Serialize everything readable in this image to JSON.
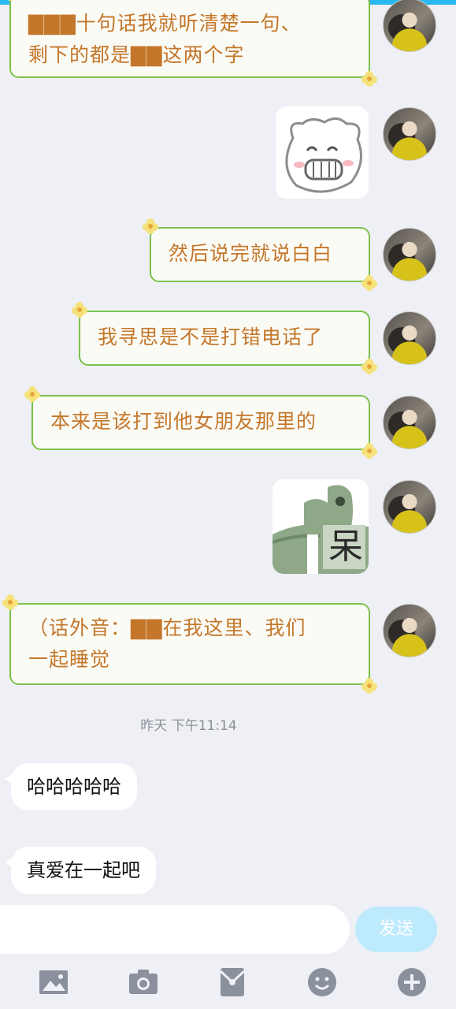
{
  "colors": {
    "accent": "#29b8f0",
    "bubble_border": "#7bc14a",
    "bubble_text": "#c4772a",
    "send_button": "#bdeafc",
    "toolbar_icon": "#8a909c"
  },
  "messages_sent": [
    {
      "lines": [
        "▇▇▇十句话我就听清楚一句、",
        "剩下的都是▇▇这两个字"
      ]
    },
    {
      "sticker": "smiling-pig-sticker"
    },
    {
      "lines": [
        "然后说完就说白白"
      ]
    },
    {
      "lines": [
        "我寻思是不是打错电话了"
      ]
    },
    {
      "lines": [
        "本来是该打到他女朋友那里的"
      ]
    },
    {
      "sticker": "crocodile-dai-sticker",
      "text": "呆"
    },
    {
      "lines": [
        "（话外音：▇▇在我这里、我们",
        "一起睡觉"
      ]
    }
  ],
  "timestamp": "昨天 下午11:14",
  "messages_received": [
    {
      "text": "哈哈哈哈哈"
    },
    {
      "text": "真爱在一起吧"
    }
  ],
  "input": {
    "placeholder": "",
    "send_label": "发送"
  },
  "toolbar": {
    "icons": [
      "image-icon",
      "camera-icon",
      "red-packet-icon",
      "emoji-icon",
      "plus-icon"
    ]
  }
}
